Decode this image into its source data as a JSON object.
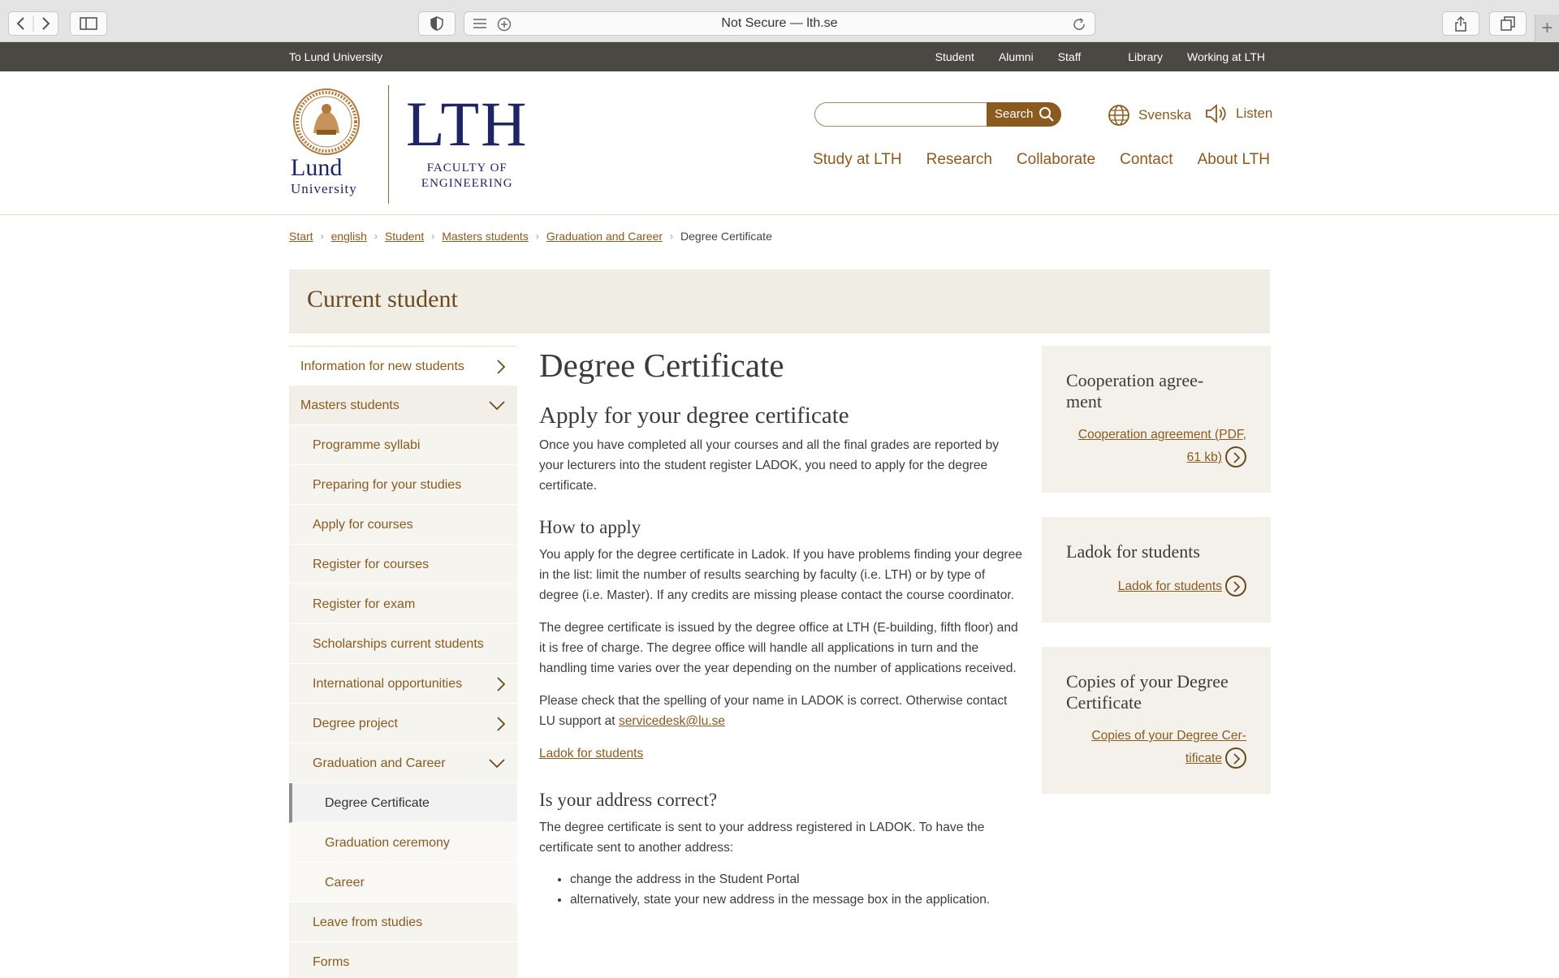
{
  "browser": {
    "url_text": "Not Secure — lth.se",
    "newtab": "+"
  },
  "utility": {
    "left": "To Lund University",
    "links": [
      "Student",
      "Alumni",
      "Staff",
      "Library",
      "Working at LTH"
    ]
  },
  "header": {
    "lu_name": "Lund",
    "lu_sub": "University",
    "lth_big": "LTH",
    "lth_sub1": "FACULTY OF",
    "lth_sub2": "ENGINEERING",
    "search_placeholder": "",
    "search_label": "Search",
    "language": "Svenska",
    "listen": "Listen",
    "nav": [
      "Study at LTH",
      "Research",
      "Collaborate",
      "Contact",
      "About LTH"
    ]
  },
  "breadcrumb": {
    "items": [
      "Start",
      "english",
      "Student",
      "Masters students",
      "Graduation and Career"
    ],
    "current": "Degree Certificate"
  },
  "banner": {
    "title": "Current student"
  },
  "sidenav": {
    "items": [
      "Information for new students",
      "Masters students",
      "Programme syllabi",
      "Preparing for your studies",
      "Apply for courses",
      "Register for courses",
      "Register for exam",
      "Scholarships current students",
      "International opportunities",
      "Degree project",
      "Graduation and Career",
      "Degree Certificate",
      "Graduation ceremony",
      "Career",
      "Leave from studies",
      "Forms"
    ]
  },
  "main": {
    "title": "Degree Certificate",
    "h_apply": "Apply for your degree certificate",
    "p_apply": "Once you have completed all your courses and all the final grades are reported by your lecturers into the student register LADOK, you need to apply for the degree certificate.",
    "h_how": "How to apply",
    "p_how1": "You apply for the degree certificate in Ladok. If you have problems finding your degree in the list: limit the number of results searching by faculty (i.e. LTH) or by type of degree (i.e. Master). If any credits are missing please contact the course coordinator.",
    "p_how2": "The degree certificate is issued by the degree office at LTH (E-building, fifth floor) and it is free of charge. The degree office will handle all applications in turn and the handling time varies over the year depending on the number of applications received.",
    "p_how3": "Please check that the spelling of your name in LADOK is correct. Otherwise contact LU support at ",
    "email": "servicedesk@lu.se",
    "ladok_link": "Ladok for students",
    "h_address": "Is your address correct?",
    "p_address": "The degree certificate is sent to your address registered in LADOK. To have the certificate sent to another address:",
    "bullets": [
      "change the address in the Student Portal",
      "alternatively, state your new address in the message box in the application."
    ]
  },
  "cards": [
    {
      "title1": "Cooperation agree-",
      "title2": "ment",
      "link1": "Cooperation agreement (PDF,",
      "link2": "61 kb)"
    },
    {
      "title1": "Ladok for students",
      "link1": "Ladok for students"
    },
    {
      "title1": "Copies of your Degree",
      "title2": "Certificate",
      "link1": "Copies of your Degree Cer-",
      "link2": "tificate"
    }
  ]
}
